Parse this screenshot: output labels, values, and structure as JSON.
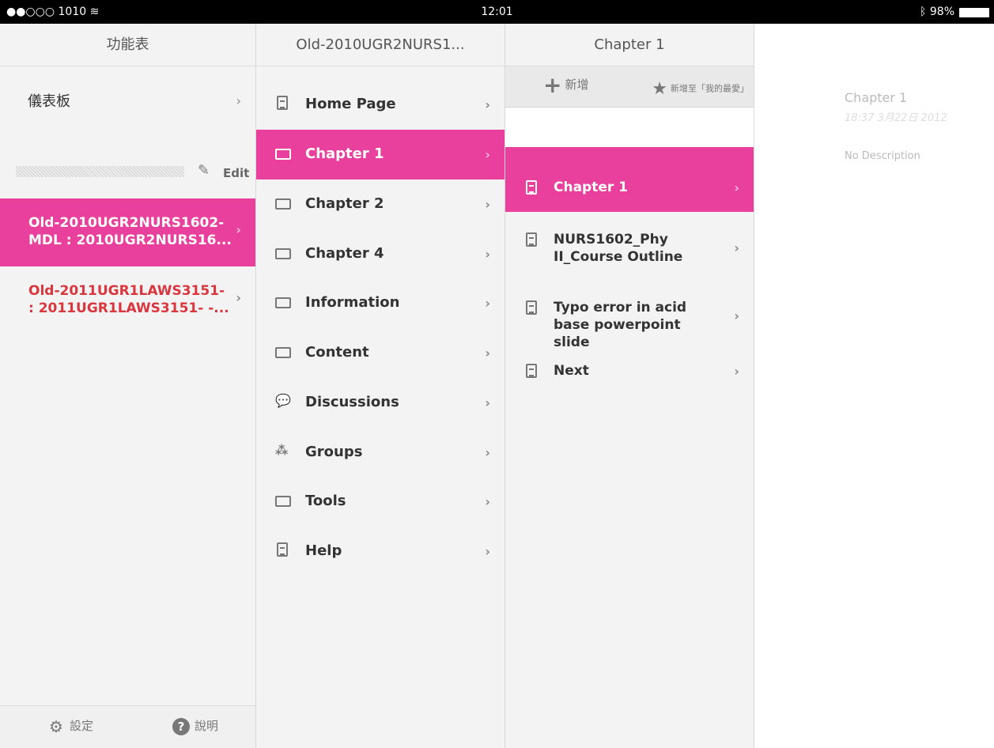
{
  "status_bar": {
    "carrier": "●●○○○ 1010",
    "wifi": "wifi-icon",
    "time": "12:01",
    "battery": "98%",
    "bluetooth": "bluetooth-icon"
  },
  "colors": {
    "accent": "#e8409c",
    "warning_text": "#d9363e",
    "panel": "#f3f3f3"
  },
  "menu": {
    "title": "功能表",
    "dashboard_label": "儀表板",
    "edit_label": "Edit",
    "courses": [
      {
        "line1": "Old-2010UGR2NURS1602-",
        "line2": "MDL : 2010UGR2NURS16..."
      },
      {
        "line1": "Old-2011UGR1LAWS3151-",
        "line2": ": 2011UGR1LAWS3151- -..."
      }
    ],
    "footer": {
      "settings_label": "設定",
      "help_label": "說明"
    }
  },
  "course_nav": {
    "title": "Old-2010UGR2NURS1...",
    "items": [
      {
        "label": "Home Page",
        "icon": "document-icon"
      },
      {
        "label": "Chapter 1",
        "icon": "folder-icon",
        "selected": true
      },
      {
        "label": "Chapter 2",
        "icon": "folder-icon"
      },
      {
        "label": "Chapter 4",
        "icon": "folder-icon"
      },
      {
        "label": "Information",
        "icon": "folder-icon"
      },
      {
        "label": "Content",
        "icon": "folder-icon"
      },
      {
        "label": "Discussions",
        "icon": "discussion-icon"
      },
      {
        "label": "Groups",
        "icon": "groups-icon"
      },
      {
        "label": "Tools",
        "icon": "folder-icon"
      },
      {
        "label": "Help",
        "icon": "document-icon"
      }
    ]
  },
  "chapter": {
    "title": "Chapter 1",
    "toolbar": {
      "add_label": "新增",
      "favorite_label": "新增至「我的最愛」"
    },
    "items": [
      {
        "label": "Chapter 1",
        "selected": true
      },
      {
        "label": "NURS1602_Phy II_Course Outline"
      },
      {
        "label": "Typo error in acid base powerpoint slide"
      },
      {
        "label": "Next"
      }
    ]
  },
  "detail": {
    "title": "Chapter 1",
    "date": "18:37 3月22日 2012",
    "description": "No Description"
  }
}
